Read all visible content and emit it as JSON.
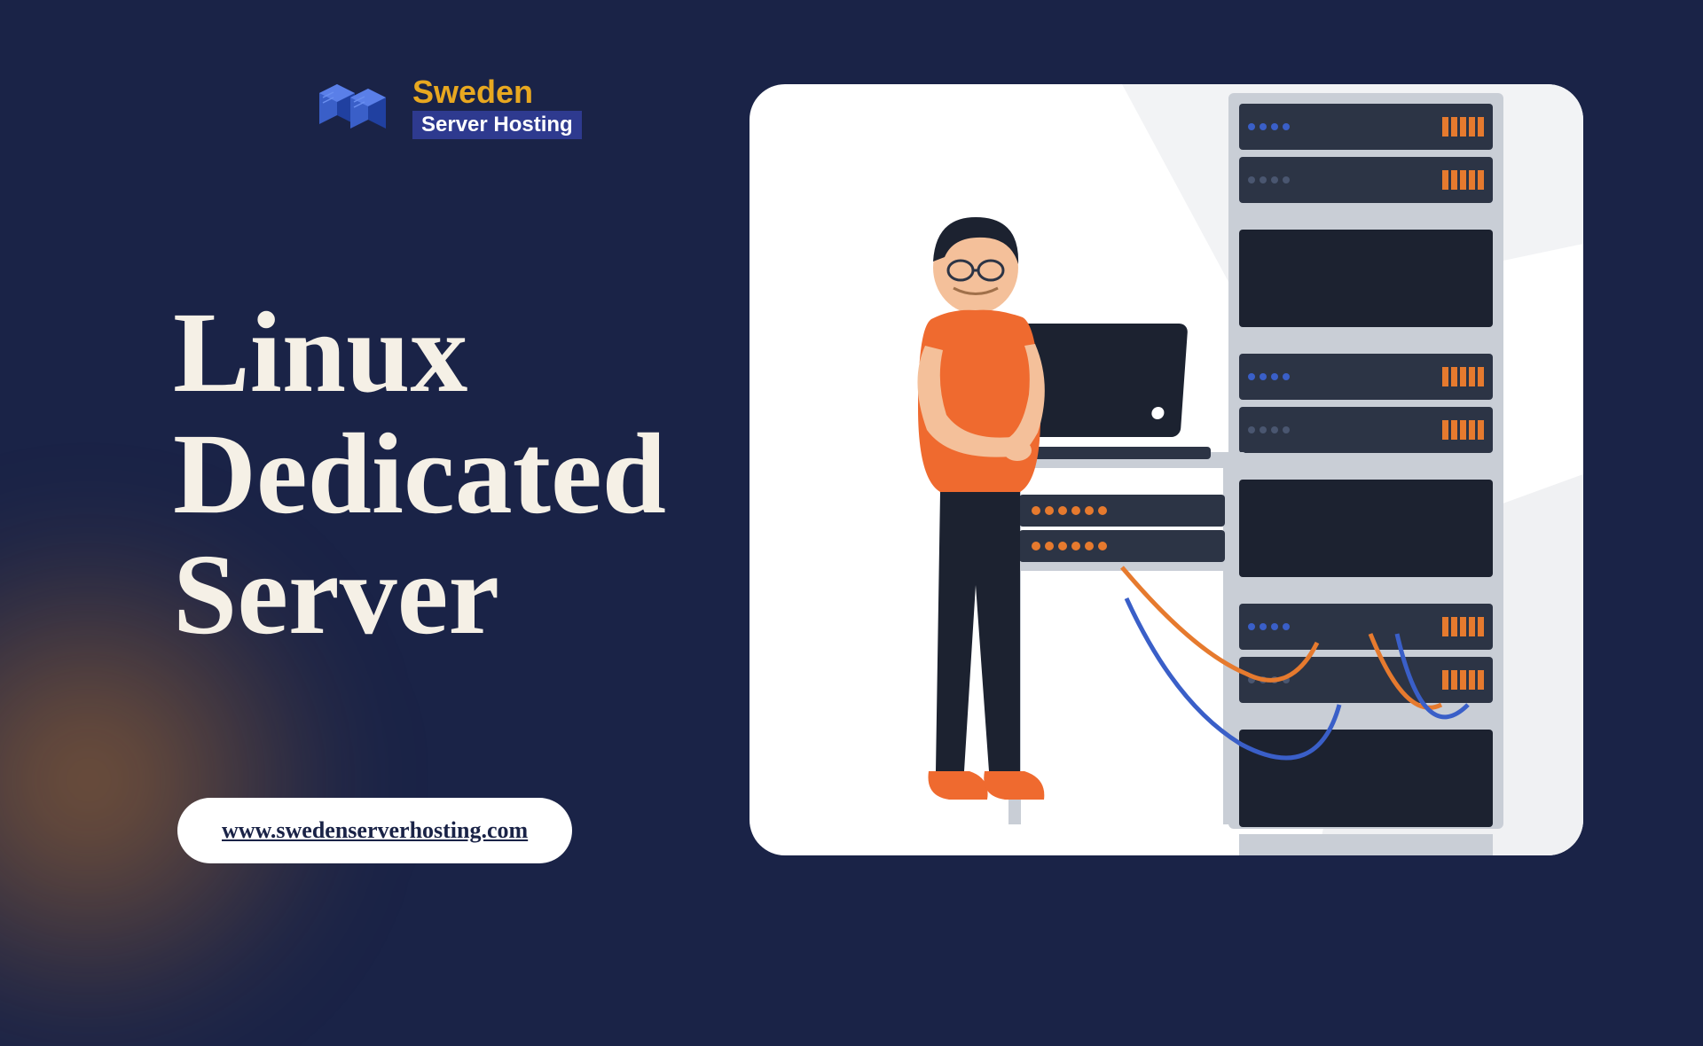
{
  "logo": {
    "brand": "Sweden",
    "subtitle": "Server Hosting"
  },
  "heading": {
    "line1": "Linux",
    "line2": "Dedicated",
    "line3": "Server"
  },
  "url": "www.swedenserverhosting.com",
  "colors": {
    "background": "#1a2347",
    "accent_orange": "#e67a2e",
    "accent_gold": "#e8a820",
    "cream": "#f5f0e6"
  },
  "icons": {
    "logo": "server-rack-isometric-icon",
    "illustration": "person-with-laptop-server-rack"
  }
}
